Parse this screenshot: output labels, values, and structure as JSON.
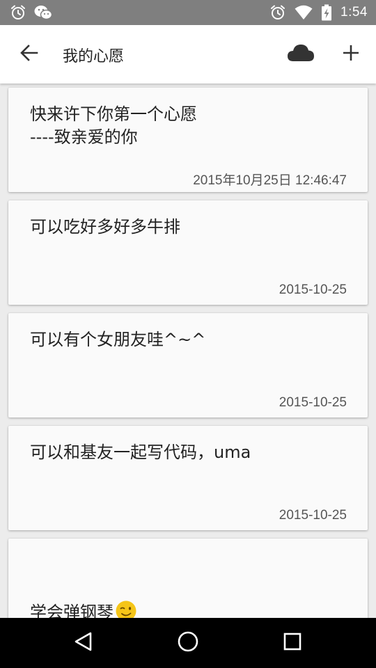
{
  "status_bar": {
    "time": "1:54",
    "left_icons": [
      "alarm-icon",
      "wechat-icon"
    ],
    "right_icons": [
      "alarm-icon",
      "wifi-icon",
      "battery-charging-icon"
    ]
  },
  "app_bar": {
    "title": "我的心愿",
    "icons": [
      "back-arrow-icon",
      "cloud-icon",
      "add-icon"
    ]
  },
  "wishes": [
    {
      "text": "快来许下你第一个心愿\n----致亲爱的你",
      "date": "2015年10月25日 12:46:47"
    },
    {
      "text": "可以吃好多好多牛排",
      "date": "2015-10-25"
    },
    {
      "text": "可以有个女朋友哇^~^",
      "date": "2015-10-25"
    },
    {
      "text": "可以和基友一起写代码，uma",
      "date": "2015-10-25"
    },
    {
      "text": "学会弹钢琴",
      "emoji": "winking-face-emoji",
      "date": ""
    }
  ],
  "nav_bar": {
    "icons": [
      "back-triangle-icon",
      "home-circle-icon",
      "recents-square-icon"
    ]
  },
  "colors": {
    "status_bar": "#7f7f7f",
    "app_bar": "#ffffff",
    "background": "#ececec",
    "card": "#fafafa",
    "nav_bar": "#000000",
    "emoji": "#f5c518"
  }
}
